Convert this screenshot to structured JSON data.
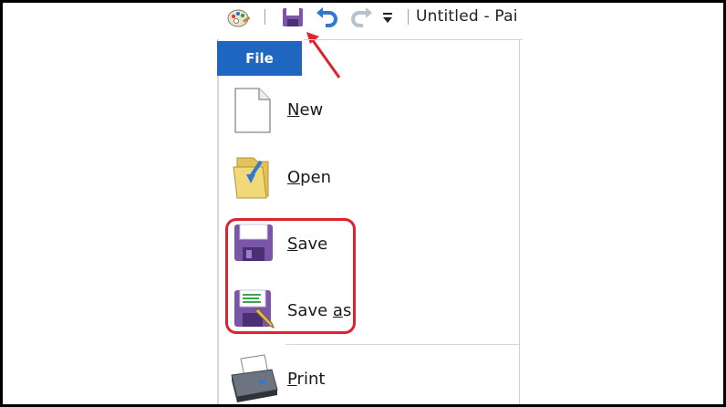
{
  "window": {
    "title": "Untitled - Pai"
  },
  "quick_access": {
    "icons": [
      "paint-app-icon",
      "save-icon",
      "undo-icon",
      "redo-icon",
      "customize-dropdown-icon"
    ]
  },
  "ribbon": {
    "file_tab": "File"
  },
  "file_menu": {
    "new": {
      "pre": "",
      "acc": "N",
      "post": "ew"
    },
    "open": {
      "pre": "",
      "acc": "O",
      "post": "pen"
    },
    "save": {
      "pre": "",
      "acc": "S",
      "post": "ave"
    },
    "save_as": {
      "pre": "Save ",
      "acc": "a",
      "post": "s"
    },
    "print": {
      "pre": "",
      "acc": "P",
      "post": "rint"
    }
  },
  "colors": {
    "file_tab": "#1f66c0",
    "annotation": "#e0222f",
    "floppy": "#7b55a8"
  }
}
